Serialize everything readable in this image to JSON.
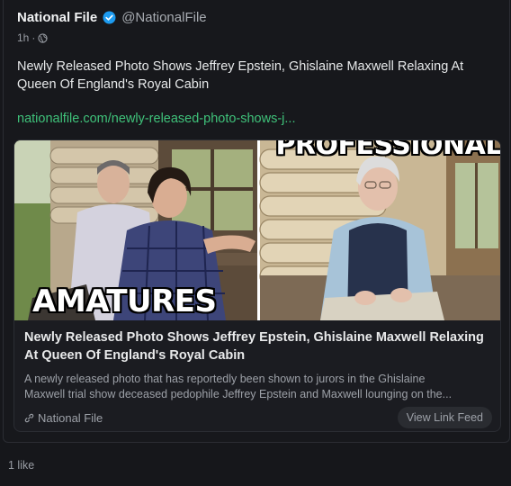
{
  "post": {
    "display_name": "National File",
    "handle": "@NationalFile",
    "time": "1h",
    "separator": "·",
    "text": "Newly Released Photo Shows Jeffrey Epstein, Ghislaine Maxwell Relaxing At Queen Of England's Royal Cabin",
    "link_text": "nationalfile.com/newly-released-photo-shows-j..."
  },
  "link_card": {
    "image_overlay_top": "PROFESSIONAL",
    "image_overlay_bottom": "AMATURES",
    "title": "Newly Released Photo Shows Jeffrey Epstein, Ghislaine Maxwell Relaxing At Queen Of England's Royal Cabin",
    "description_line1": "A newly released photo that has reportedly been shown to jurors in the Ghislaine",
    "description_line2": "Maxwell trial show deceased pedophile Jeffrey Epstein and Maxwell lounging on the...",
    "source": "National File",
    "view_button": "View Link Feed"
  },
  "footer": {
    "likes": "1 like"
  },
  "icons": {
    "verified": "verified-badge-icon",
    "visibility": "globe-icon",
    "source": "link-icon"
  },
  "colors": {
    "link": "#3fc27a",
    "verified": "#1d9bf0",
    "background": "#16171b"
  }
}
